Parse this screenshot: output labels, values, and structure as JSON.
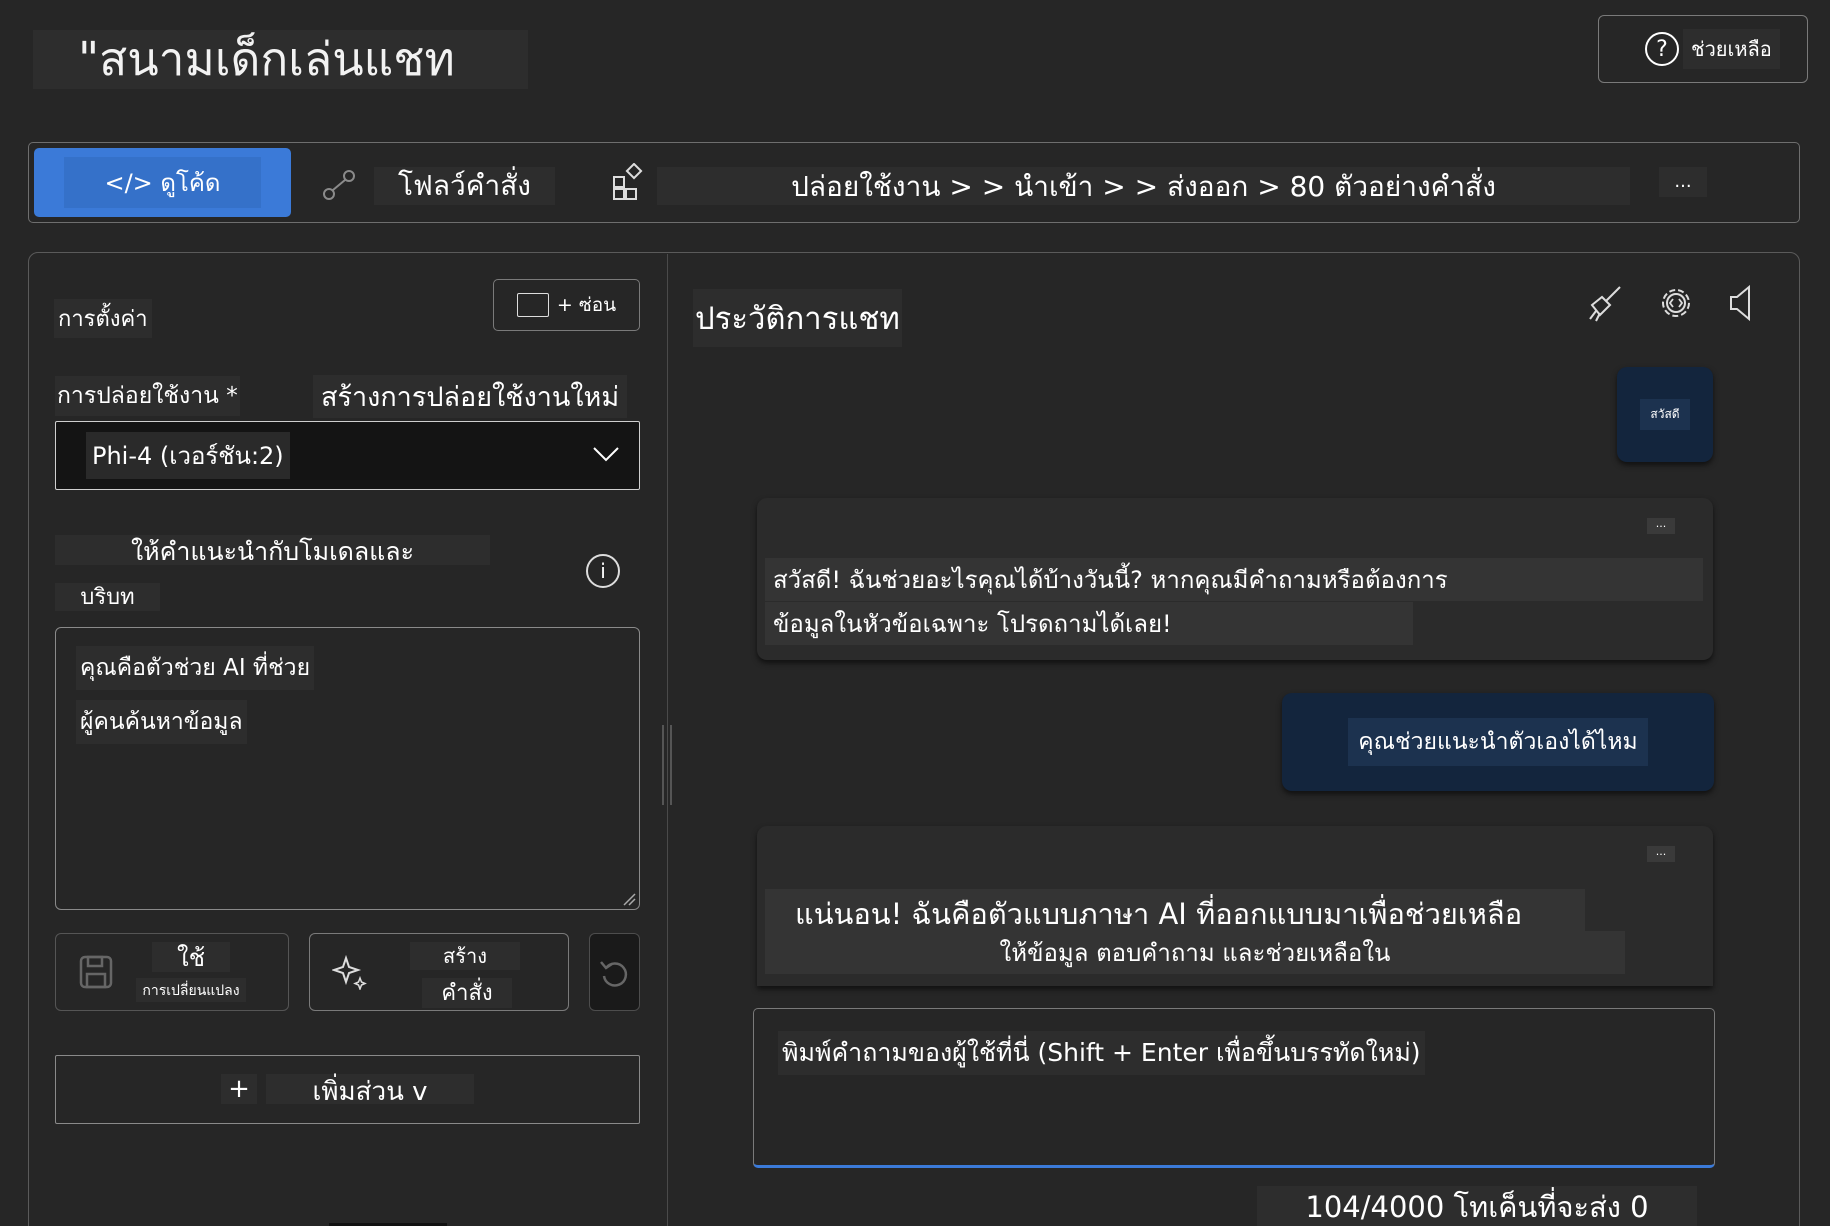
{
  "header": {
    "title": "\"สนามเด็กเล่นแชท",
    "help_label": "ช่วยเหลือ"
  },
  "toolbar": {
    "view_code": "</> ดูโค้ด",
    "prompt_flow": "โฟลว์คำสั่ง",
    "deploy_path": "ปล่อยใช้งาน > > นำเข้า > > ส่งออก > 80 ตัวอย่างคำสั่ง",
    "more": "..."
  },
  "settings": {
    "title": "การตั้งค่า",
    "hide_label": "ซ่อน",
    "deployment_label": "การปล่อยใช้งาน *",
    "new_deployment": "สร้างการปล่อยใช้งานใหม่",
    "deployment_value": "Phi-4 (เวอร์ชัน:2)",
    "instructions_line1": "ให้คำแนะนำกับโมเดลและ",
    "instructions_line2": "บริบท",
    "system_message_line1": "คุณคือตัวช่วย AI ที่ช่วย",
    "system_message_line2": "ผู้คนค้นหาข้อมูล",
    "apply_label": "ใช้",
    "apply_sub": "การเปลี่ยนแปลง",
    "generate_line1": "สร้าง",
    "generate_line2": "คำสั่ง",
    "add_plus": "+",
    "add_section": "เพิ่มส่วน v"
  },
  "chat": {
    "title": "ประวัติการแชท",
    "messages": [
      {
        "role": "user",
        "text": "สวัสดี"
      },
      {
        "role": "assistant",
        "line1": "สวัสดี! ฉันช่วยอะไรคุณได้บ้างวันนี้? หากคุณมีคำถามหรือต้องการ",
        "line2": "ข้อมูลในหัวข้อเฉพาะ โปรดถามได้เลย!",
        "more": "..."
      },
      {
        "role": "user",
        "text": "คุณช่วยแนะนำตัวเองได้ไหม"
      },
      {
        "role": "assistant",
        "line1": "แน่นอน! ฉันคือตัวแบบภาษา AI ที่ออกแบบมาเพื่อช่วยเหลือ",
        "line2": "ให้ข้อมูล ตอบคำถาม และช่วยเหลือใน",
        "more": "..."
      }
    ],
    "input_placeholder": "พิมพ์คำถามของผู้ใช้ที่นี่ (Shift + Enter เพื่อขึ้นบรรทัดใหม่)",
    "token_count": "104/4000 โทเค็นที่จะส่ง 0"
  },
  "colors": {
    "accent": "#3b7ad8",
    "background": "#262626",
    "user_bubble": "#13253d",
    "assistant_bubble": "#2b2b2b"
  }
}
